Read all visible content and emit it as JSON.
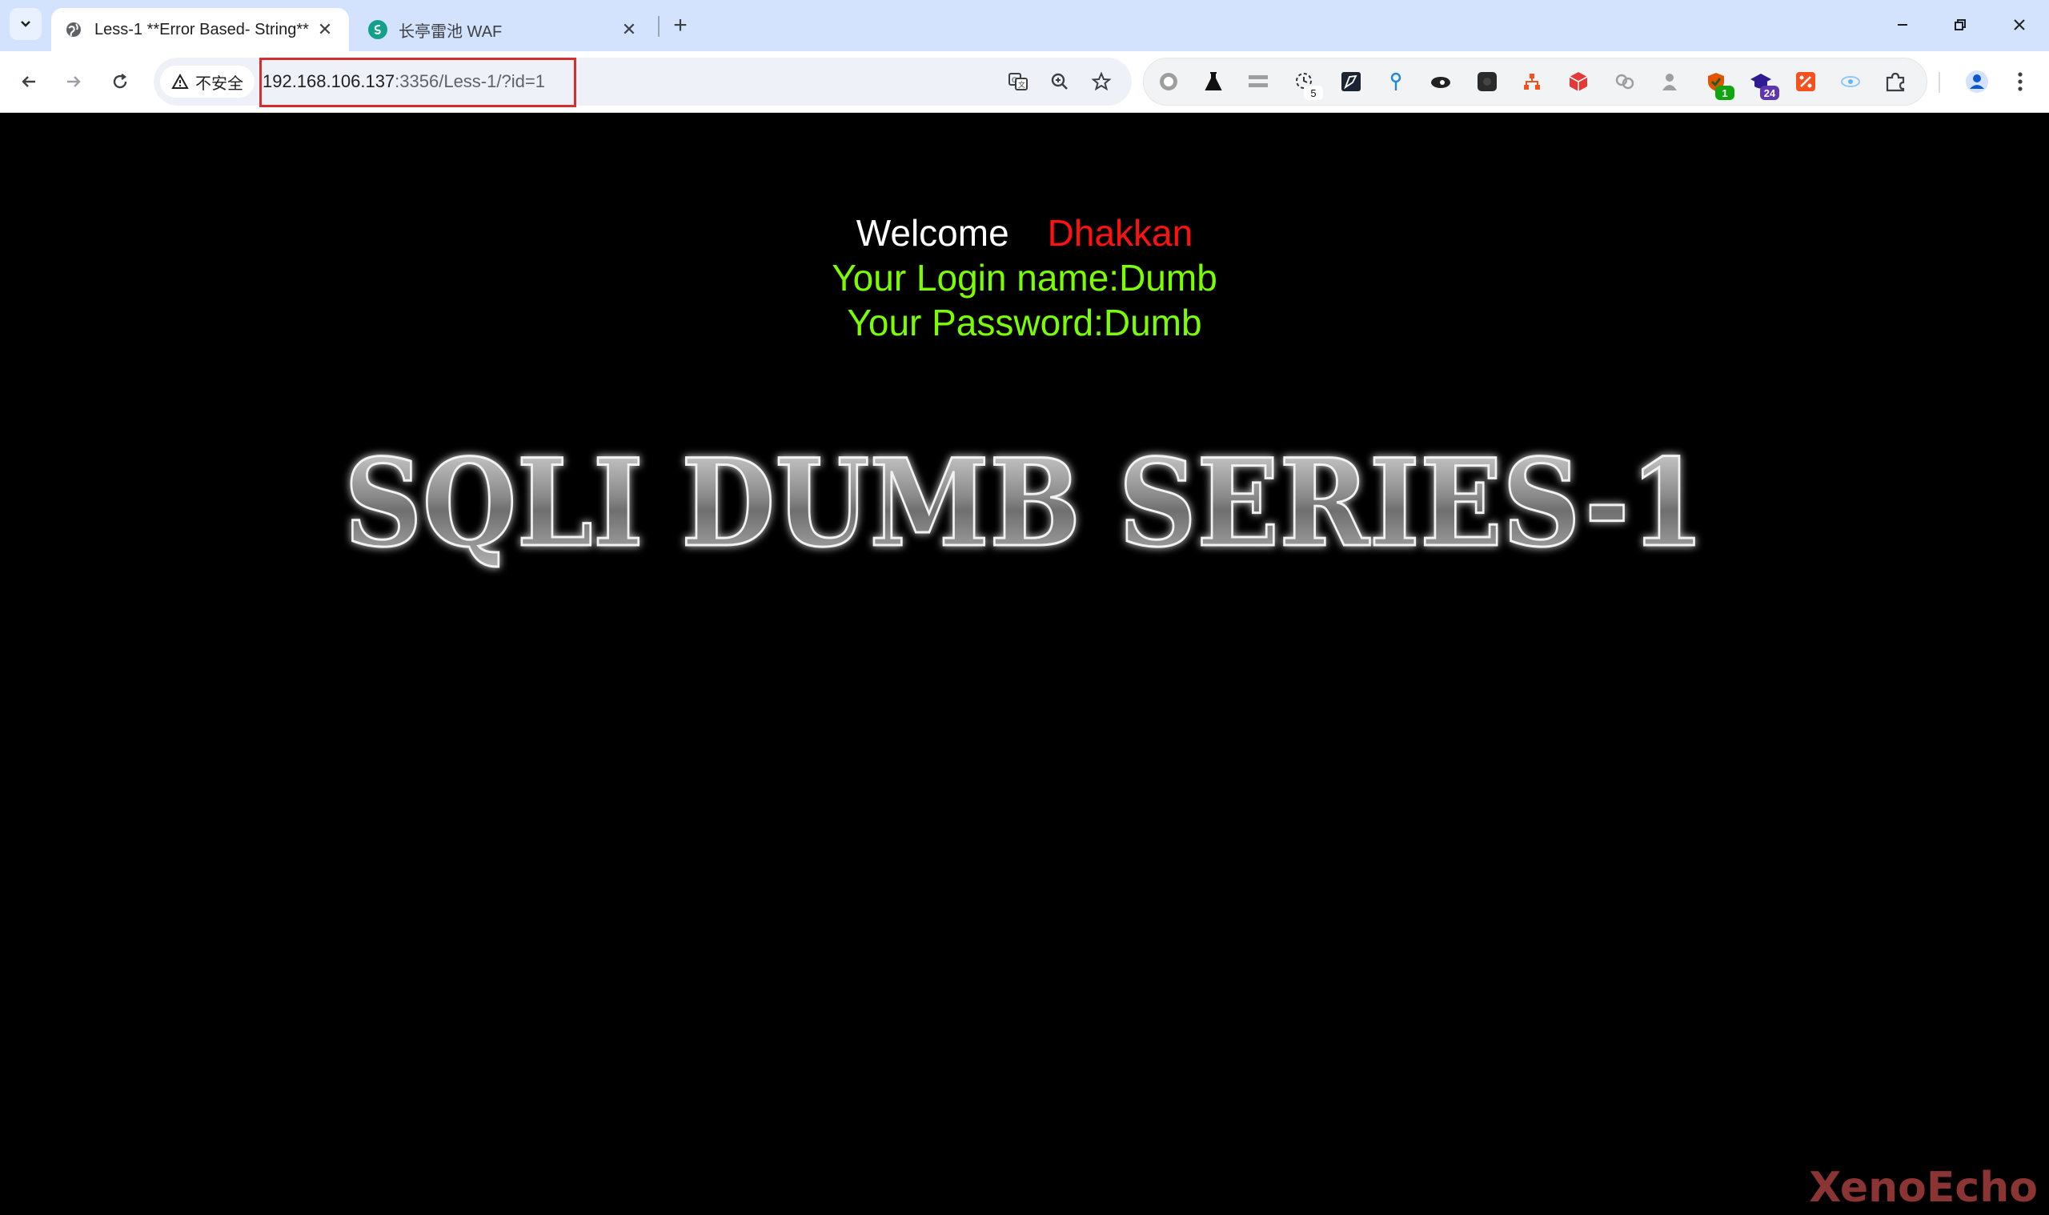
{
  "browser": {
    "tabs": [
      {
        "title": "Less-1 **Error Based- String**",
        "active": true
      },
      {
        "title": "长亭雷池 WAF",
        "active": false
      }
    ],
    "new_tab_label": "+",
    "security_chip": "不安全",
    "url_host": "192.168.106.137",
    "url_path": ":3356/Less-1/?id=1",
    "extension_badges": {
      "ext_clock": "5",
      "ext_shield": "1",
      "ext_hat": "24"
    }
  },
  "page": {
    "welcome_label": "Welcome",
    "welcome_name": "Dhakkan",
    "login_line": "Your Login name:Dumb",
    "password_line": "Your Password:Dumb",
    "banner_text": "SQLI DUMB SERIES-1",
    "watermark": "XenoEcho"
  },
  "colors": {
    "page_background": "#000000",
    "welcome_name": "#ff1111",
    "info_text": "#7cfc00",
    "url_highlight_border": "#d32f2f",
    "tabstrip": "#d3e3fd"
  }
}
